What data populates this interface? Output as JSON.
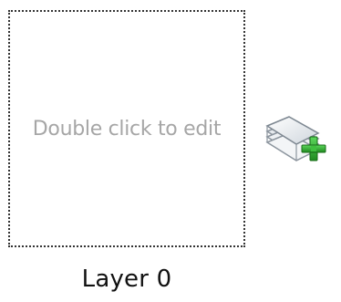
{
  "layer": {
    "placeholder": "Double click to edit",
    "name": "Layer 0"
  },
  "icons": {
    "add_layer": "add-layer-icon"
  },
  "colors": {
    "border": "#333333",
    "placeholder": "#a6a6a6",
    "plus": "#2e9e2e"
  }
}
